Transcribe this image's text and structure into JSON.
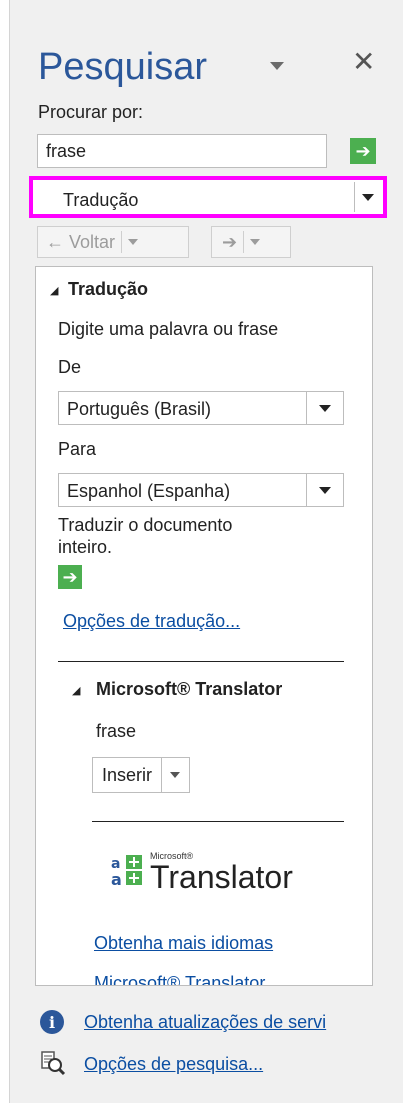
{
  "pane": {
    "title": "Pesquisar",
    "search_for_label": "Procurar por:",
    "search_value": "frase",
    "source_selected": "Tradução",
    "back_label": "← Voltar",
    "forward_label": "➔"
  },
  "translation": {
    "section_title": "Tradução",
    "instruction": "Digite uma palavra ou frase",
    "from_label": "De",
    "from_value": "Português (Brasil)",
    "to_label": "Para",
    "to_value": "Espanhol (Espanha)",
    "translate_doc_line1": "Traduzir o documento",
    "translate_doc_line2": "inteiro.",
    "options_link": "Opções de tradução..."
  },
  "ms_translator": {
    "section_title": "Microsoft® Translator",
    "result_word": "frase",
    "insert_label": "Inserir",
    "logo_small": "Microsoft®",
    "logo_big": "Translator",
    "more_languages_link": "Obtenha mais idiomas",
    "cut_link": "Microsoft® Translator"
  },
  "footer": {
    "updates_link": "Obtenha atualizações de servi",
    "options_link": "Opções de pesquisa..."
  },
  "colors": {
    "title_blue": "#2b579a",
    "highlight": "#ff00ff",
    "go_green": "#4caf50",
    "link_blue": "#0b4ea2"
  }
}
